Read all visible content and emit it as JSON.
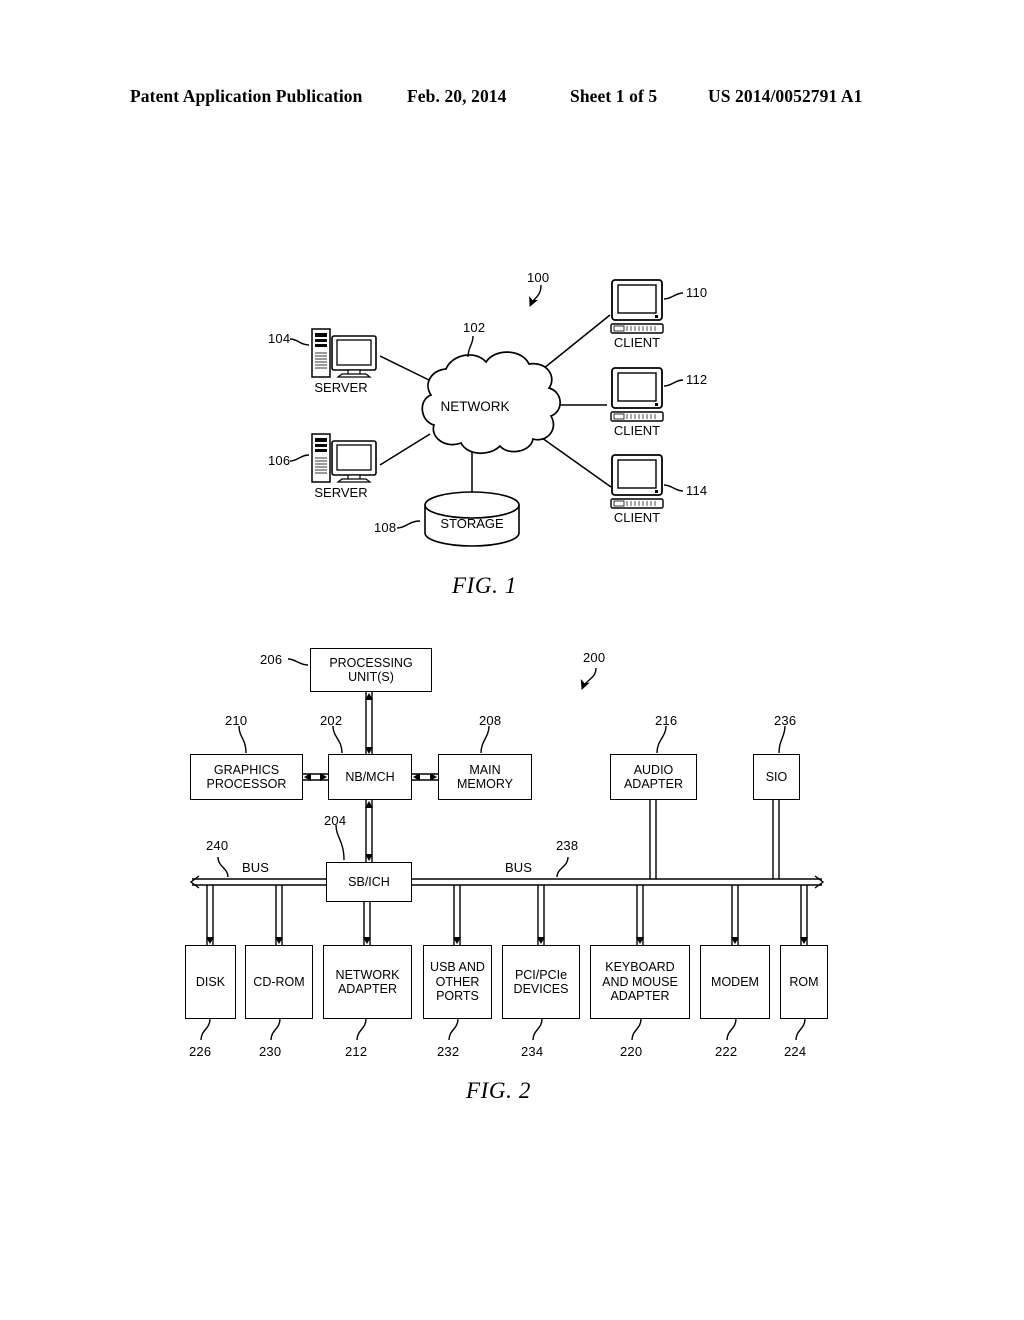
{
  "header": {
    "publication": "Patent Application Publication",
    "date": "Feb. 20, 2014",
    "sheet": "Sheet 1 of 5",
    "patent_number": "US 2014/0052791 A1"
  },
  "figure1": {
    "caption": "FIG. 1",
    "ref_main": "100",
    "nodes": {
      "network": {
        "label": "NETWORK",
        "ref": "102"
      },
      "server_top": {
        "label": "SERVER",
        "ref": "104"
      },
      "server_bottom": {
        "label": "SERVER",
        "ref": "106"
      },
      "storage": {
        "label": "STORAGE",
        "ref": "108"
      },
      "client_top": {
        "label": "CLIENT",
        "ref": "110"
      },
      "client_middle": {
        "label": "CLIENT",
        "ref": "112"
      },
      "client_bottom": {
        "label": "CLIENT",
        "ref": "114"
      }
    }
  },
  "figure2": {
    "caption": "FIG. 2",
    "ref_main": "200",
    "bus_label_left": "BUS",
    "bus_label_right": "BUS",
    "blocks": {
      "processing_unit": {
        "label_line1": "PROCESSING",
        "label_line2": "UNIT(S)",
        "ref": "206"
      },
      "graphics_processor": {
        "label_line1": "GRAPHICS",
        "label_line2": "PROCESSOR",
        "ref": "210"
      },
      "nb_mch": {
        "label_line1": "NB/MCH",
        "ref": "202"
      },
      "main_memory": {
        "label_line1": "MAIN",
        "label_line2": "MEMORY",
        "ref": "208"
      },
      "audio_adapter": {
        "label_line1": "AUDIO",
        "label_line2": "ADAPTER",
        "ref": "216"
      },
      "sio": {
        "label_line1": "SIO",
        "ref": "236"
      },
      "sb_ich": {
        "label_line1": "SB/ICH",
        "ref": "204"
      },
      "bus_left": {
        "ref": "240"
      },
      "bus_right": {
        "ref": "238"
      },
      "disk": {
        "label_line1": "DISK",
        "ref": "226"
      },
      "cdrom": {
        "label_line1": "CD-ROM",
        "ref": "230"
      },
      "network_adapter": {
        "label_line1": "NETWORK",
        "label_line2": "ADAPTER",
        "ref": "212"
      },
      "usb_ports": {
        "label_line1": "USB AND",
        "label_line2": "OTHER",
        "label_line3": "PORTS",
        "ref": "232"
      },
      "pci_devices": {
        "label_line1": "PCI/PCIe",
        "label_line2": "DEVICES",
        "ref": "234"
      },
      "keyboard_mouse": {
        "label_line1": "KEYBOARD",
        "label_line2": "AND MOUSE",
        "label_line3": "ADAPTER",
        "ref": "220"
      },
      "modem": {
        "label_line1": "MODEM",
        "ref": "222"
      },
      "rom": {
        "label_line1": "ROM",
        "ref": "224"
      }
    }
  },
  "colors": {
    "ink": "#000000",
    "paper": "#ffffff"
  }
}
